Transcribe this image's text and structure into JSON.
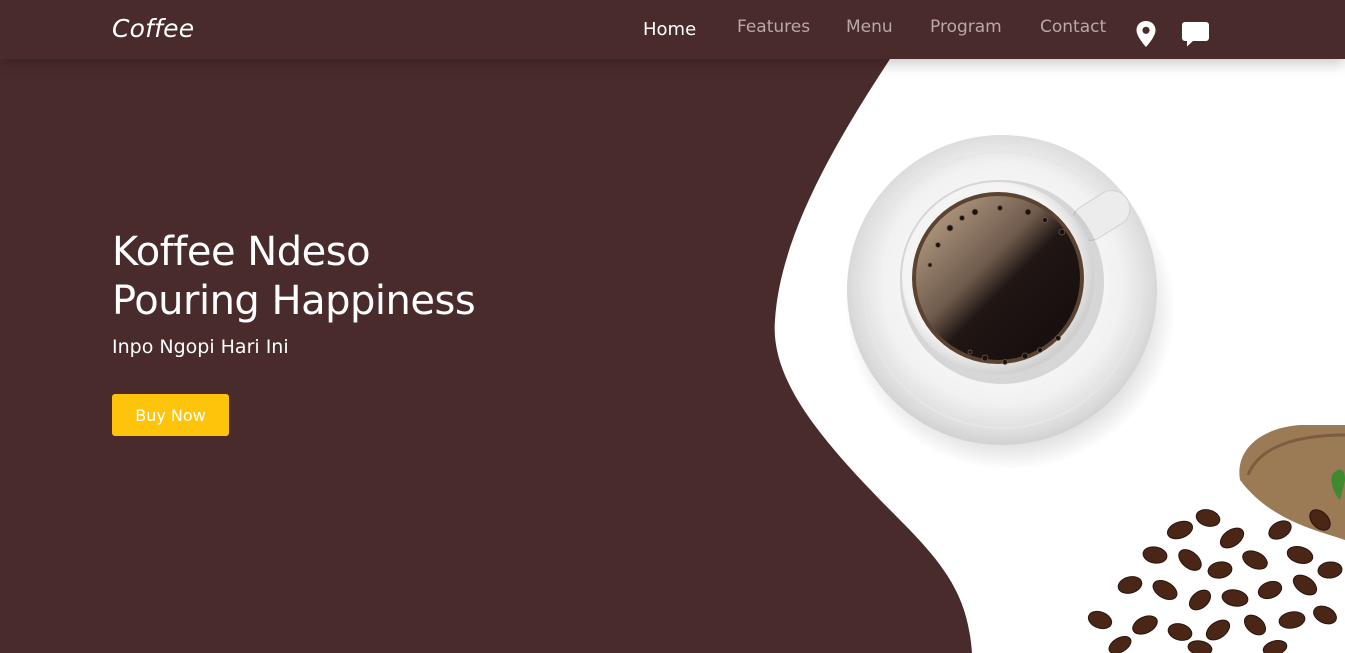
{
  "navbar": {
    "brand": "Coffee",
    "links": [
      {
        "label": "Home",
        "active": true
      },
      {
        "label": "Features",
        "active": false
      },
      {
        "label": "Menu",
        "active": false
      },
      {
        "label": "Program",
        "active": false
      },
      {
        "label": "Contact",
        "active": false
      }
    ],
    "icons": [
      "map-marker-icon",
      "chat-icon"
    ]
  },
  "hero": {
    "title_line1": "Koffee Ndeso",
    "title_line2": "Pouring Happiness",
    "subtitle": "Inpo Ngopi Hari Ini",
    "cta_label": "Buy Now",
    "images": [
      "coffee-cup-image",
      "coffee-beans-image"
    ]
  },
  "colors": {
    "background": "#4a2b2b",
    "accent": "#fec40b",
    "nav_inactive": "#b9a8a8",
    "text": "#ffffff"
  }
}
